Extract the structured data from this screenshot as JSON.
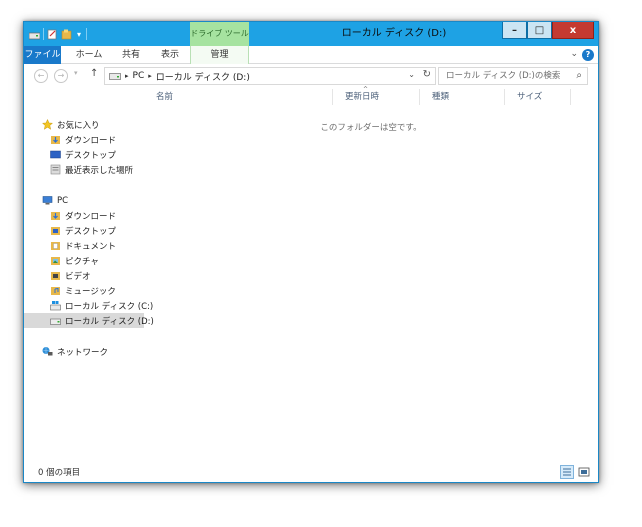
{
  "window": {
    "title": "ローカル ディスク (D:)",
    "context_tab_group": "ドライブ ツール"
  },
  "caption": {
    "minimize": "–",
    "maximize": "□",
    "close": "x"
  },
  "quick_access": {
    "dropdown": "▾"
  },
  "ribbon": {
    "tabs": [
      "ファイル",
      "ホーム",
      "共有",
      "表示",
      "管理"
    ],
    "expand": "⌄",
    "help": "?"
  },
  "address": {
    "back": "←",
    "forward": "→",
    "recent": "▾",
    "up": "↑",
    "crumbs": [
      "PC",
      "ローカル ディスク (D:)"
    ],
    "crumb_separator": "▸",
    "dropdown": "⌄",
    "refresh": "↻"
  },
  "search": {
    "placeholder": "ローカル ディスク (D:)の検索",
    "icon_glyph": "⌕"
  },
  "nav": {
    "favorites": {
      "label": "お気に入り",
      "items": [
        "ダウンロード",
        "デスクトップ",
        "最近表示した場所"
      ]
    },
    "pc": {
      "label": "PC",
      "items": [
        "ダウンロード",
        "デスクトップ",
        "ドキュメント",
        "ピクチャ",
        "ビデオ",
        "ミュージック",
        "ローカル ディスク (C:)",
        "ローカル ディスク (D:)"
      ]
    },
    "network": {
      "label": "ネットワーク"
    }
  },
  "columns": [
    "名前",
    "更新日時",
    "種類",
    "サイズ"
  ],
  "sort_indicator": "^",
  "empty_message": "このフォルダーは空です。",
  "status": {
    "item_count": "0 個の項目"
  },
  "colors": {
    "titlebar": "#1ea2e4",
    "file_tab": "#1979ca",
    "context_tab": "#a6e3a0",
    "close_button": "#c43a31",
    "folder": "#e8b84a",
    "selected_item": "#d9d9d9"
  }
}
